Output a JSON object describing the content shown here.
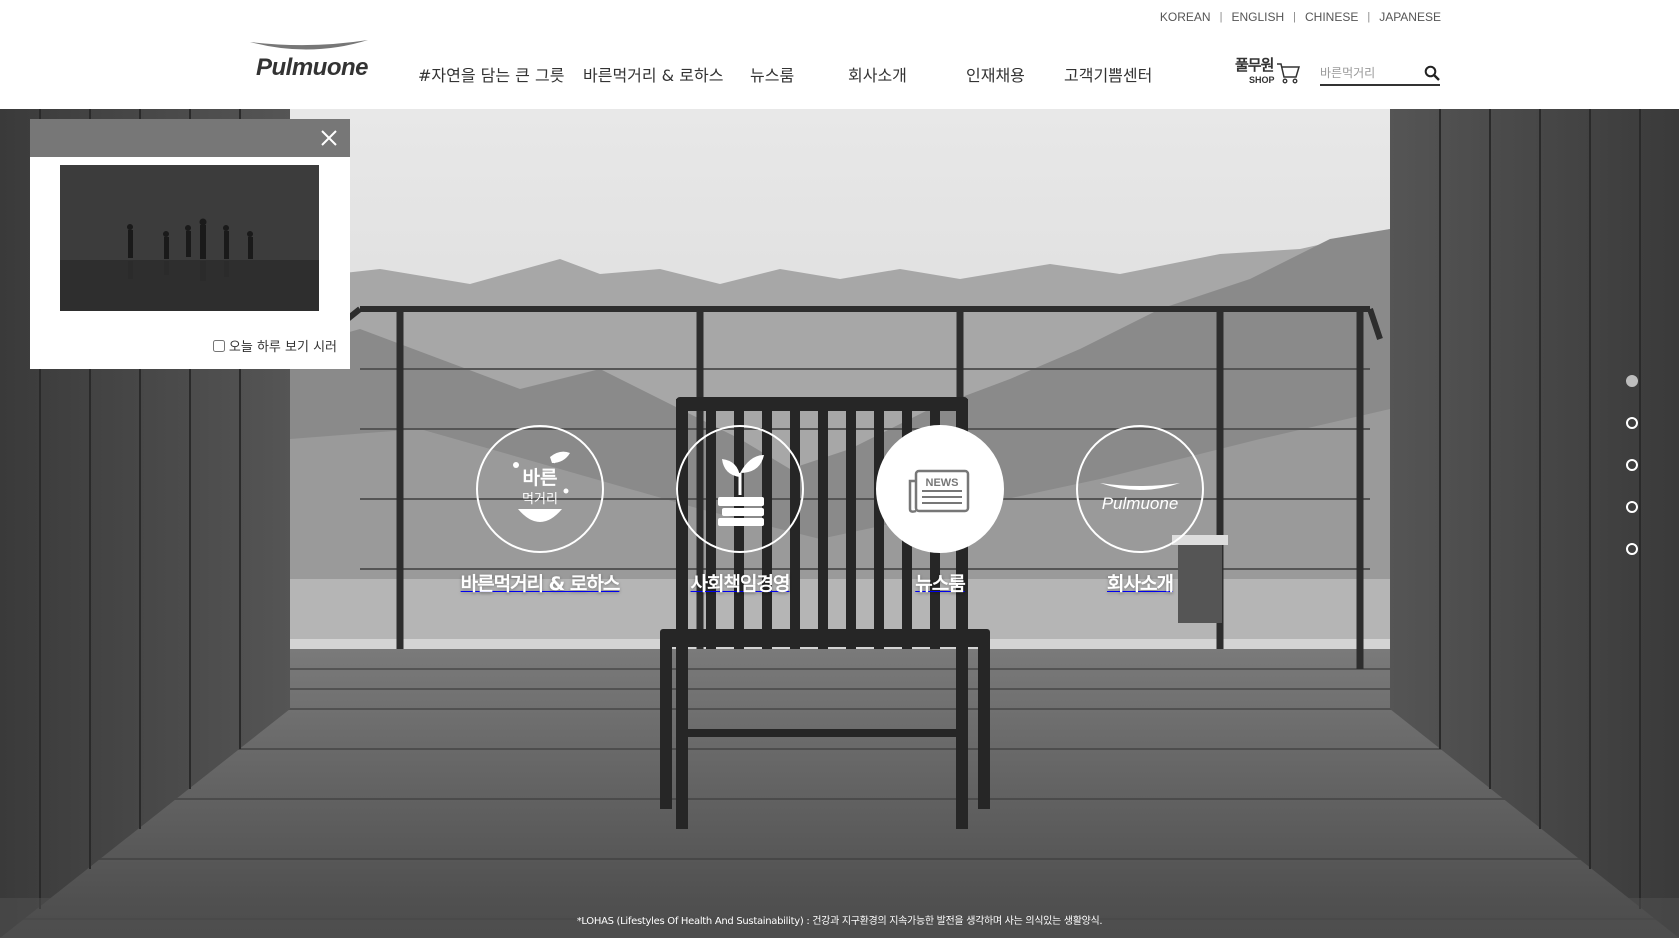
{
  "header": {
    "languages": [
      "KOREAN",
      "ENGLISH",
      "CHINESE",
      "JAPANESE"
    ],
    "logo_text": "Pulmuone",
    "nav": [
      "#자연을 담는 큰 그릇",
      "바른먹거리 & 로하스",
      "뉴스룸",
      "회사소개",
      "인재채용",
      "고객기쁨센터"
    ],
    "shop": {
      "label": "풀무원",
      "sub": "SHOP"
    },
    "search": {
      "placeholder": "바른먹거리"
    }
  },
  "hero": {
    "quick_links": [
      {
        "label": "바른먹거리 & 로하스",
        "icon": "bareun-meokgeori-icon",
        "icon_text_1": "바른",
        "icon_text_2": "먹거리"
      },
      {
        "label": "사회책임경영",
        "icon": "sprout-books-icon"
      },
      {
        "label": "뉴스룸",
        "icon": "news-icon",
        "icon_text": "NEWS",
        "active": true
      },
      {
        "label": "회사소개",
        "icon": "pulmuone-logo-icon",
        "icon_text": "Pulmuone"
      }
    ],
    "pagination": {
      "count": 5,
      "active_index": 0
    },
    "footnote": "*LOHAS (Lifestyles Of Health And Sustainability) : 건강과 지구환경의 지속가능한 발전을 생각하며 사는 의식있는 생활양식."
  },
  "popup": {
    "checkbox_label": "오늘 하루 보기 시러",
    "checked": false
  },
  "colors": {
    "header_bg": "#ffffff",
    "popup_bar": "#777777",
    "text": "#333333"
  }
}
